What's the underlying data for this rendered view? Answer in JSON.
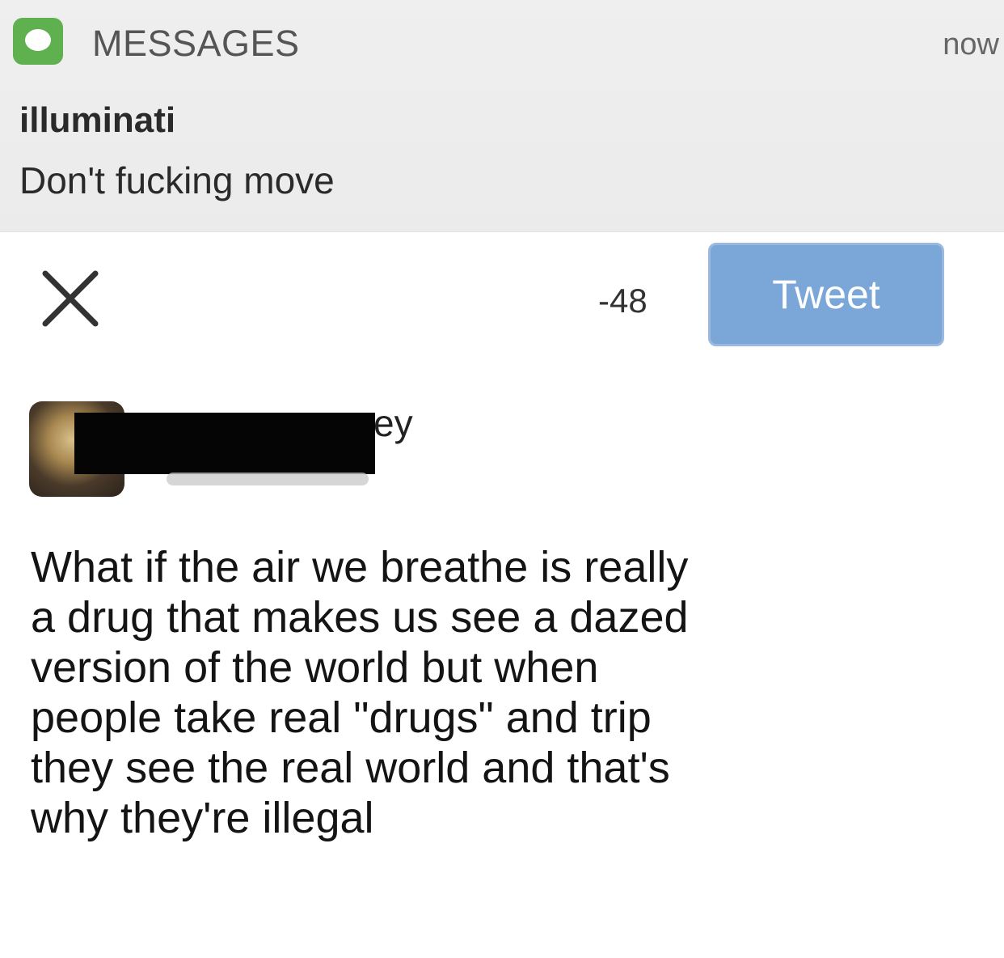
{
  "notification": {
    "app_name": "MESSAGES",
    "time": "now",
    "sender": "illuminati",
    "message": "Don't fucking move",
    "app_icon": "messages-bubble-icon",
    "accent_color": "#5fb04f"
  },
  "compose": {
    "close_icon": "close-icon",
    "char_counter": "-48",
    "tweet_button_label": "Tweet",
    "tweet_button_color": "#7aa6d8",
    "author_name_visible_suffix": "ey",
    "tweet_lines": [
      "What if the air we breathe is really",
      "a drug that makes us see a dazed",
      "version of the world but when",
      "people take real \"drugs\" and trip",
      "they see the real world and that's",
      "why they're illegal"
    ]
  }
}
